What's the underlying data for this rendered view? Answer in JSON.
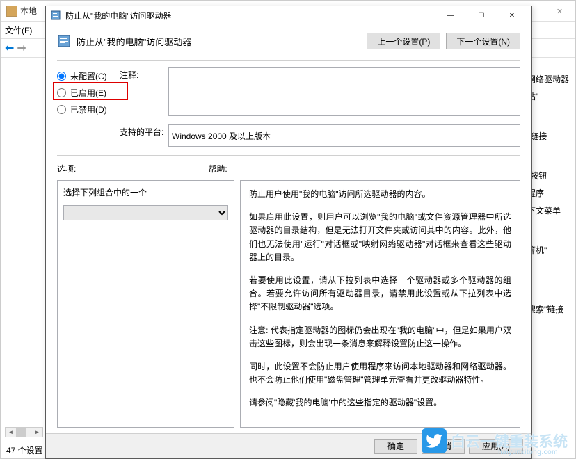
{
  "bg_window": {
    "title": "本地",
    "file_menu": "文件(F)",
    "close": "✕",
    "status": "47 个设置",
    "sidebar_items": [
      "网络驱动器",
      "站\"",
      "\"链接",
      "\"按钮",
      "程序",
      "下文菜单",
      "算机\"",
      "搜索\"链接"
    ]
  },
  "dialog": {
    "title": "防止从\"我的电脑\"访问驱动器",
    "header_text": "防止从\"我的电脑\"访问驱动器",
    "prev_btn": "上一个设置(P)",
    "next_btn": "下一个设置(N)",
    "radios": {
      "not_configured": "未配置(C)",
      "enabled": "已启用(E)",
      "disabled": "已禁用(D)"
    },
    "comment_label": "注释:",
    "comment_value": "",
    "platform_label": "支持的平台:",
    "platform_value": "Windows 2000 及以上版本",
    "options_label": "选项:",
    "help_label": "帮助:",
    "options_text": "选择下列组合中的一个",
    "help_paragraphs": [
      "防止用户使用\"我的电脑\"访问所选驱动器的内容。",
      "如果启用此设置，则用户可以浏览\"我的电脑\"或文件资源管理器中所选驱动器的目录结构，但是无法打开文件夹或访问其中的内容。此外，他们也无法使用\"运行\"对话框或\"映射网络驱动器\"对话框来查看这些驱动器上的目录。",
      "若要使用此设置，请从下拉列表中选择一个驱动器或多个驱动器的组合。若要允许访问所有驱动器目录，请禁用此设置或从下拉列表中选择\"不限制驱动器\"选项。",
      "注意: 代表指定驱动器的图标仍会出现在\"我的电脑\"中，但是如果用户双击这些图标，则会出现一条消息来解释设置防止这一操作。",
      "同时，此设置不会防止用户使用程序来访问本地驱动器和网络驱动器。也不会防止他们使用\"磁盘管理\"管理单元查看并更改驱动器特性。",
      "请参阅\"隐藏'我的电脑'中的这些指定的驱动器\"设置。"
    ],
    "ok_btn": "确定",
    "cancel_btn": "取消",
    "apply_btn": "应用(A)"
  },
  "watermark": {
    "text": "白云一键重装系统",
    "url": "haiyunxitong.com"
  }
}
